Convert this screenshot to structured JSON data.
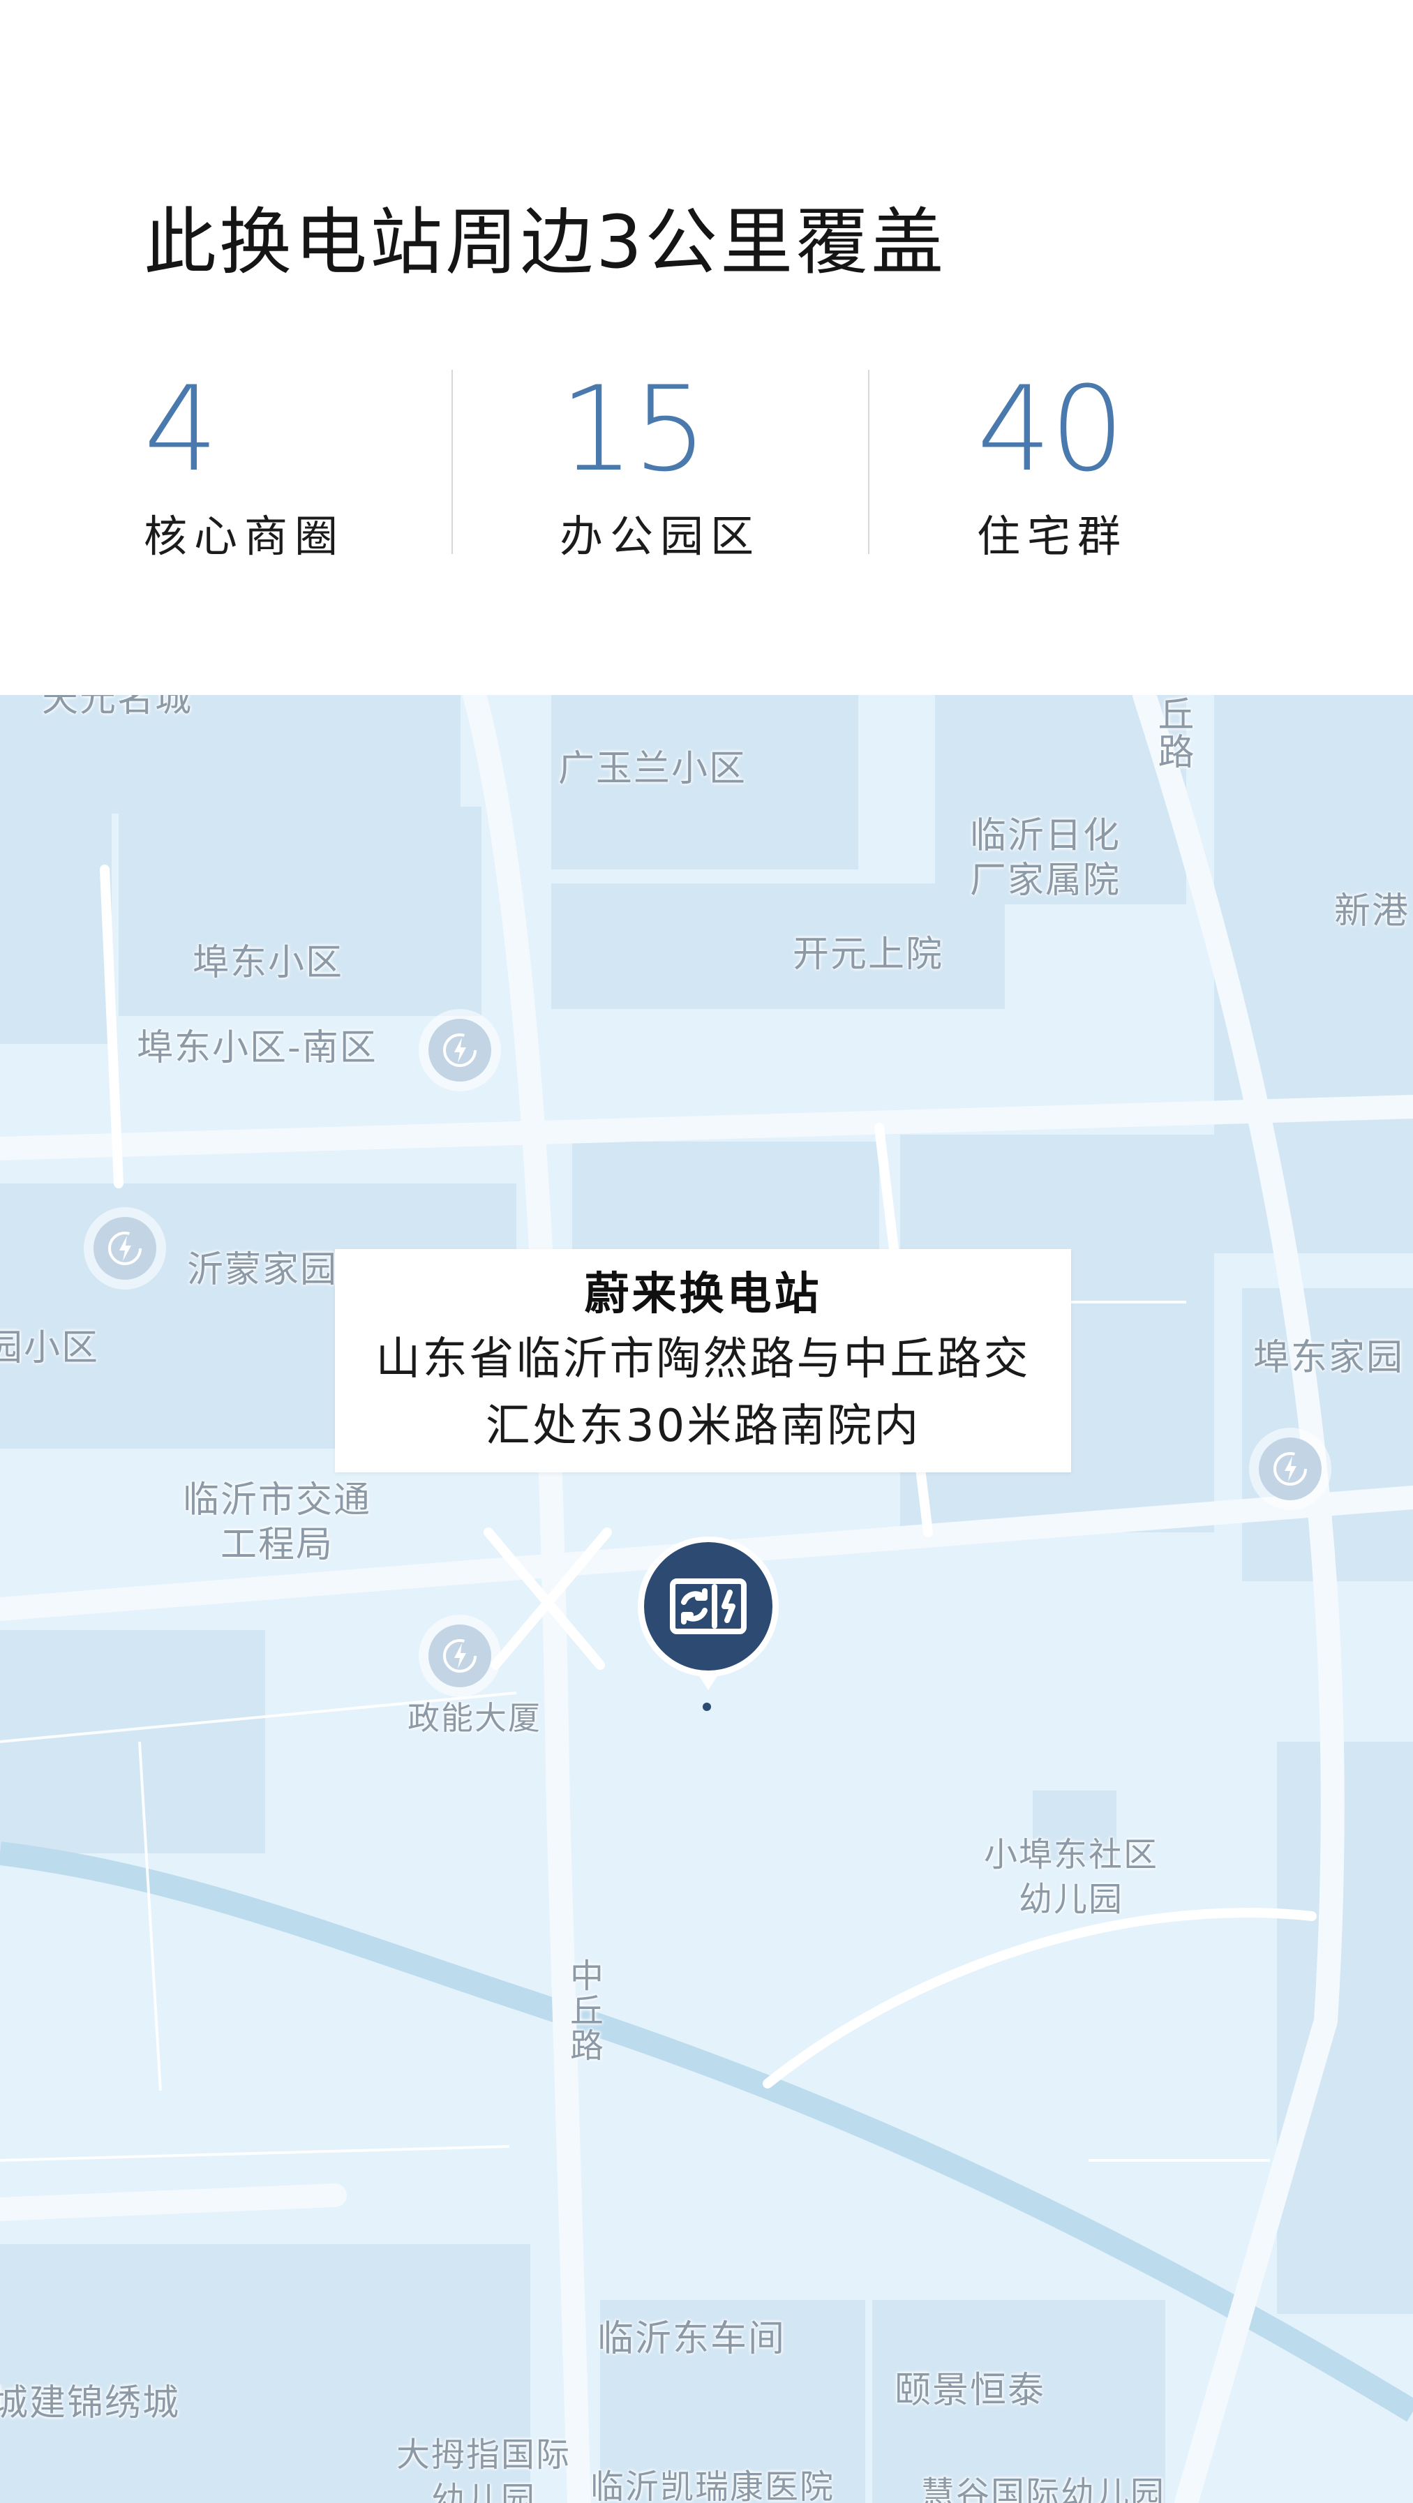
{
  "header": {
    "title": "此换电站周边3公里覆盖",
    "stats": [
      {
        "value": "4",
        "label": "核心商圈"
      },
      {
        "value": "15",
        "label": "办公园区"
      },
      {
        "value": "40",
        "label": "住宅群"
      }
    ]
  },
  "map": {
    "labels": {
      "tianyuan": "天元名城",
      "guangyulan": "广玉兰小区",
      "qiu_road_north": "丘路",
      "linyi_rihua": "临沂日化\n厂家属院",
      "xingang": "新港",
      "kaiyuan": "开元上院",
      "budong": "埠东小区",
      "budong_south": "埠东小区-南区",
      "yimeng": "沂蒙家园",
      "left_xiaoqu": "园小区",
      "budong_jiayuan": "埠东家园",
      "jiaotong": "临沂市交通\n工程局",
      "zhengneng": "政能大厦",
      "xiaobudong": "小埠东社区\n幼儿园",
      "zhongqiu_road": "中丘路",
      "linyi_dongchejian": "临沂东车间",
      "jianjin": "城建锦绣城",
      "yijing": "颐景恒泰",
      "damuzhi": "大拇指国际\n幼儿园",
      "kairui": "临沂凯瑞康医院",
      "kindergarten_br": "慧谷国际幼儿园"
    },
    "callout": {
      "title": "蔚来换电站",
      "address": "山东省临沂市陶然路与中丘路交汇处东30米路南院内"
    },
    "icons": {
      "swap_station": "battery-swap-icon",
      "charge_points": "lightning-charge-icon"
    },
    "colors": {
      "stat_blue": "#4a79ae",
      "marker_navy": "#2c4a72",
      "map_water": "#bcdcee",
      "map_block": "#d2e6f4",
      "map_background": "#e4f2fb"
    }
  }
}
